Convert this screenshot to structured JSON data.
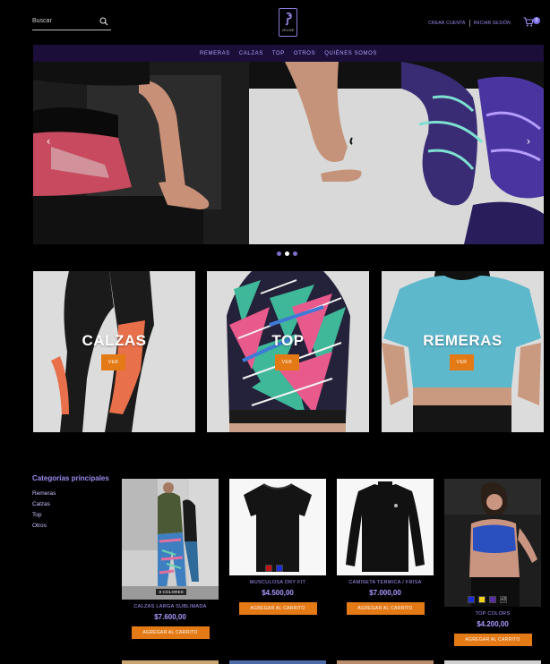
{
  "header": {
    "search_placeholder": "Buscar",
    "logo_text": "JEUNE",
    "create_account": "CREAR CUENTA",
    "login": "INICIAR SESIÓN",
    "cart_count": "0"
  },
  "nav": [
    "REMERAS",
    "CALZAS",
    "TOP",
    "OTROS",
    "QUIÉNES SOMOS"
  ],
  "slider": {
    "prev": "‹",
    "next": "›",
    "dots": 3,
    "active_dot": 1
  },
  "banners": [
    {
      "title": "CALZAS",
      "button": "VER"
    },
    {
      "title": "TOP",
      "button": "VER"
    },
    {
      "title": "REMERAS",
      "button": "VER"
    }
  ],
  "categories": {
    "title": "Categorías principales",
    "items": [
      "Remeras",
      "Calzas",
      "Top",
      "Otros"
    ]
  },
  "products": [
    {
      "name": "CALZAS LARGA SUBLIMADA",
      "price": "$7.600,00",
      "button": "AGREGAR AL CARRITO",
      "tag": "8 COLORES"
    },
    {
      "name": "MUSCULOSA DRY FIT",
      "price": "$4.500,00",
      "button": "AGREGAR AL CARRITO"
    },
    {
      "name": "CAMISETA TERMICA / FRISA",
      "price": "$7.000,00",
      "button": "AGREGAR AL CARRITO"
    },
    {
      "name": "TOP COLORS",
      "price": "$4.200,00",
      "button": "AGREGAR AL CARRITO",
      "more_colors": "+3"
    }
  ],
  "colors": {
    "accent": "#e47a16",
    "nav_bg": "#1b0e38",
    "link": "#9b8cf0"
  }
}
